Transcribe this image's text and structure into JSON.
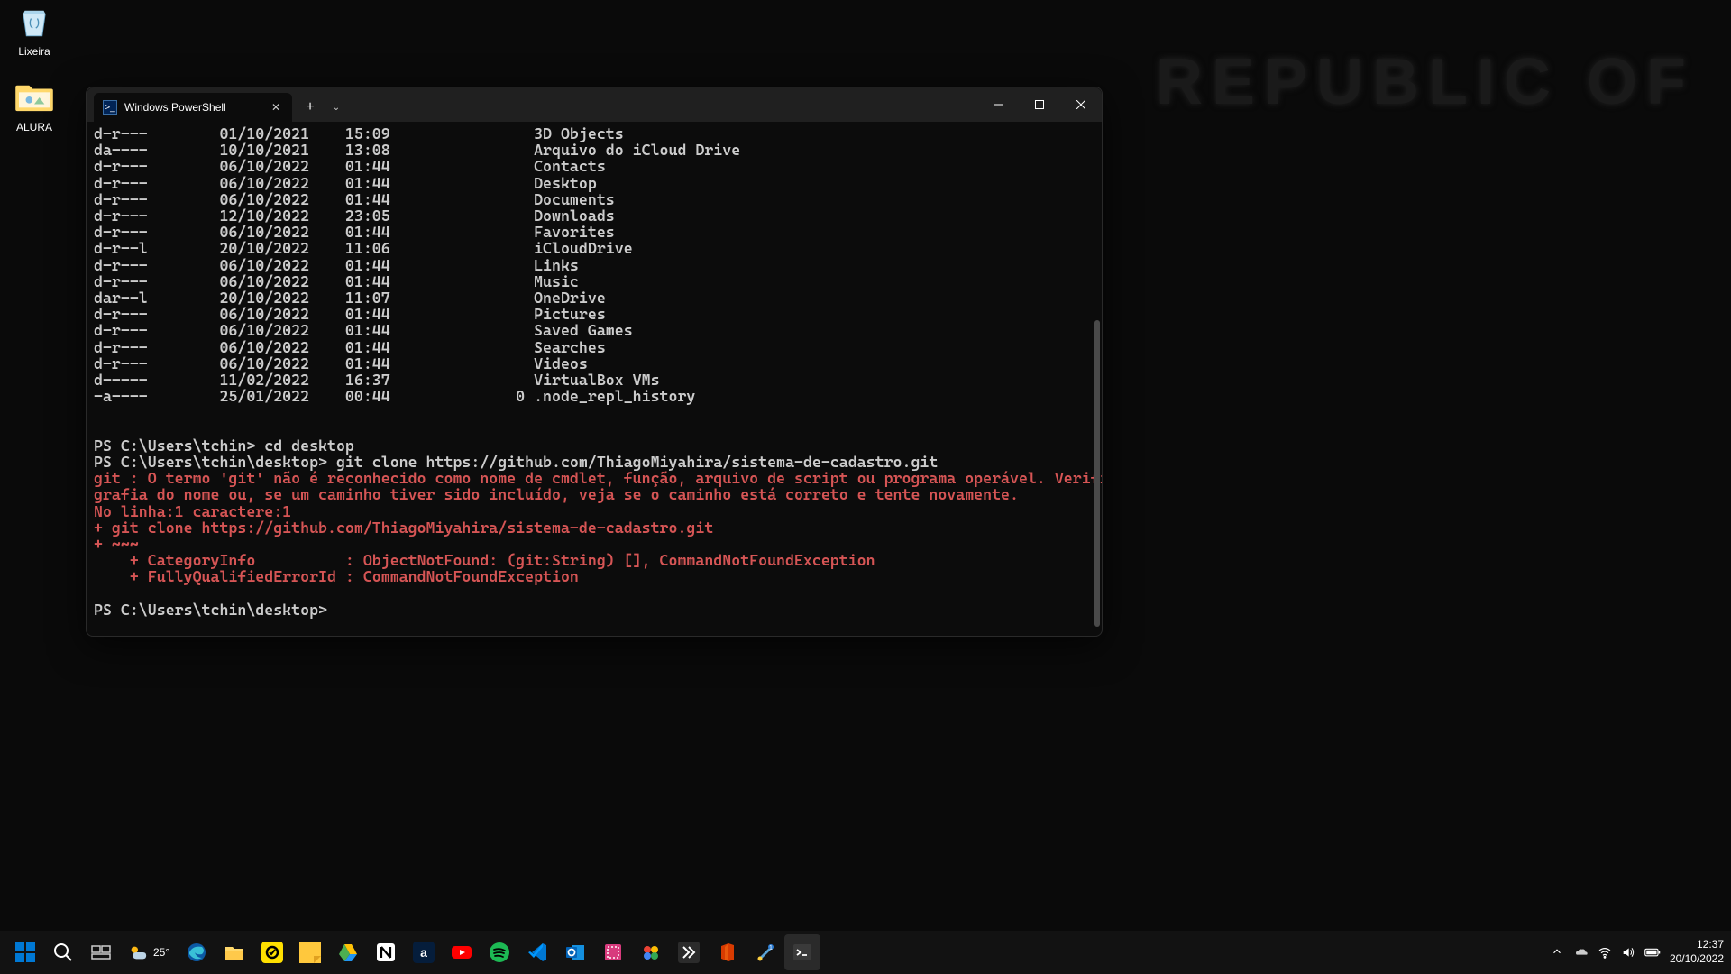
{
  "desktop": {
    "recycle_bin": "Lixeira",
    "folder_alura": "ALURA",
    "wallpaper_text": "REPUBLIC OF"
  },
  "terminal": {
    "tab_title": "Windows PowerShell",
    "listing": [
      {
        "mode": "d-r---",
        "date": "01/10/2021",
        "time": "15:09",
        "size": "",
        "name": "3D Objects"
      },
      {
        "mode": "da----",
        "date": "10/10/2021",
        "time": "13:08",
        "size": "",
        "name": "Arquivo do iCloud Drive"
      },
      {
        "mode": "d-r---",
        "date": "06/10/2022",
        "time": "01:44",
        "size": "",
        "name": "Contacts"
      },
      {
        "mode": "d-r---",
        "date": "06/10/2022",
        "time": "01:44",
        "size": "",
        "name": "Desktop"
      },
      {
        "mode": "d-r---",
        "date": "06/10/2022",
        "time": "01:44",
        "size": "",
        "name": "Documents"
      },
      {
        "mode": "d-r---",
        "date": "12/10/2022",
        "time": "23:05",
        "size": "",
        "name": "Downloads"
      },
      {
        "mode": "d-r---",
        "date": "06/10/2022",
        "time": "01:44",
        "size": "",
        "name": "Favorites"
      },
      {
        "mode": "d-r--l",
        "date": "20/10/2022",
        "time": "11:06",
        "size": "",
        "name": "iCloudDrive"
      },
      {
        "mode": "d-r---",
        "date": "06/10/2022",
        "time": "01:44",
        "size": "",
        "name": "Links"
      },
      {
        "mode": "d-r---",
        "date": "06/10/2022",
        "time": "01:44",
        "size": "",
        "name": "Music"
      },
      {
        "mode": "dar--l",
        "date": "20/10/2022",
        "time": "11:07",
        "size": "",
        "name": "OneDrive"
      },
      {
        "mode": "d-r---",
        "date": "06/10/2022",
        "time": "01:44",
        "size": "",
        "name": "Pictures"
      },
      {
        "mode": "d-r---",
        "date": "06/10/2022",
        "time": "01:44",
        "size": "",
        "name": "Saved Games"
      },
      {
        "mode": "d-r---",
        "date": "06/10/2022",
        "time": "01:44",
        "size": "",
        "name": "Searches"
      },
      {
        "mode": "d-r---",
        "date": "06/10/2022",
        "time": "01:44",
        "size": "",
        "name": "Videos"
      },
      {
        "mode": "d-----",
        "date": "11/02/2022",
        "time": "16:37",
        "size": "",
        "name": "VirtualBox VMs"
      },
      {
        "mode": "-a----",
        "date": "25/01/2022",
        "time": "00:44",
        "size": "0",
        "name": ".node_repl_history"
      }
    ],
    "prompt1": "PS C:\\Users\\tchin> ",
    "cmd1": "cd desktop",
    "prompt2": "PS C:\\Users\\tchin\\desktop> ",
    "cmd2": "git clone https://github.com/ThiagoMiyahira/sistema-de-cadastro.git",
    "err1": "git : O termo 'git' não é reconhecido como nome de cmdlet, função, arquivo de script ou programa operável. Verifique a",
    "err2": "grafia do nome ou, se um caminho tiver sido incluído, veja se o caminho está correto e tente novamente.",
    "err3": "No linha:1 caractere:1",
    "err4": "+ git clone https://github.com/ThiagoMiyahira/sistema-de-cadastro.git",
    "err5": "+ ~~~",
    "err6": "    + CategoryInfo          : ObjectNotFound: (git:String) [], CommandNotFoundException",
    "err7": "    + FullyQualifiedErrorId : CommandNotFoundException",
    "prompt3": "PS C:\\Users\\tchin\\desktop>"
  },
  "taskbar": {
    "weather_temp": "25°",
    "time": "12:37",
    "date": "20/10/2022"
  }
}
